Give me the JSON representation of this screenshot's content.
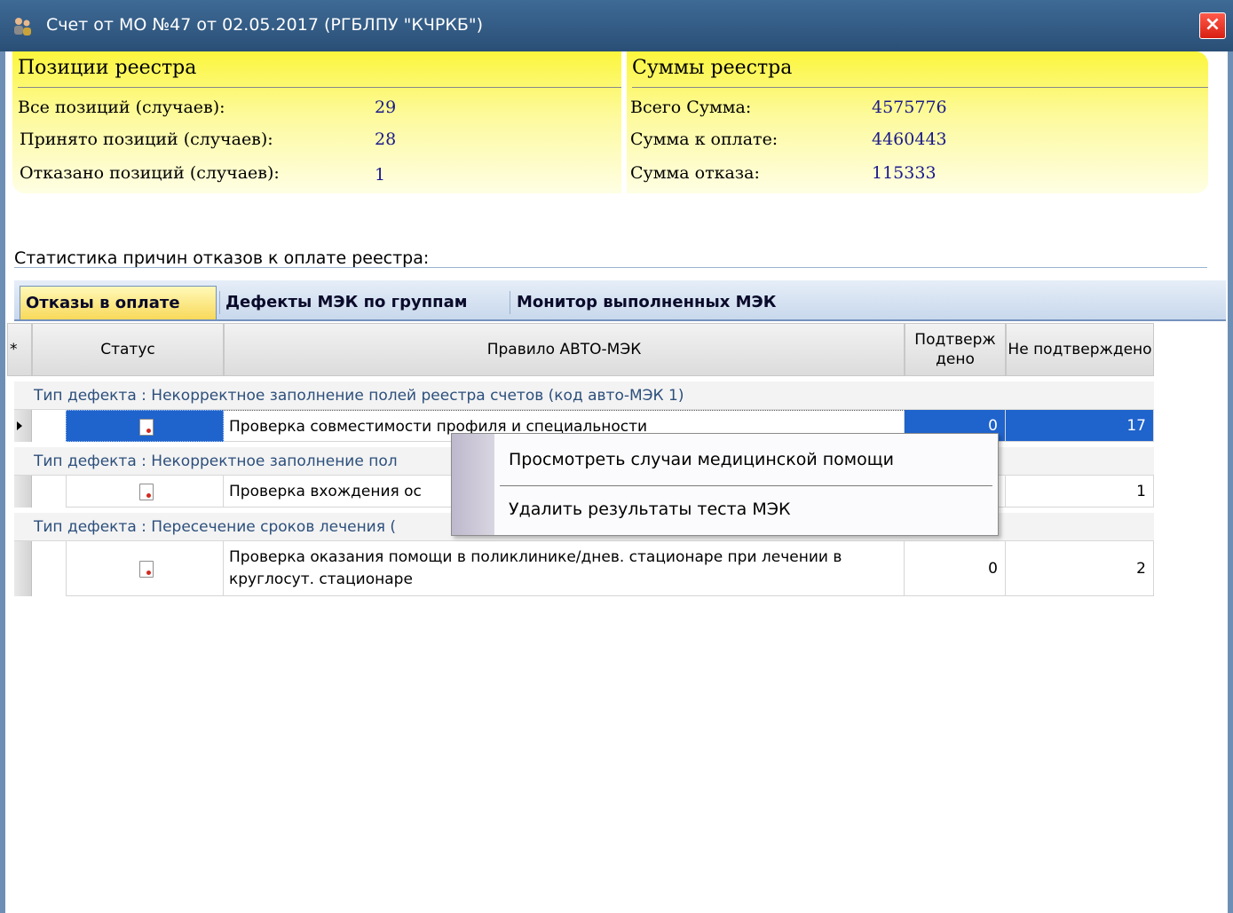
{
  "window": {
    "title": "Счет от МО №47 от 02.05.2017 (РГБЛПУ \"КЧРКБ\")",
    "close_label": "×"
  },
  "positions": {
    "header": "Позиции реестра",
    "all_label": "Все позиций (случаев):",
    "all_value": "29",
    "accepted_label": "Принято позиций (случаев):",
    "accepted_value": "28",
    "rejected_label": "Отказано позиций (случаев):",
    "rejected_value": "1"
  },
  "sums": {
    "header": "Суммы реестра",
    "total_label": "Всего Сумма:",
    "total_value": "4575776",
    "to_pay_label": "Сумма к оплате:",
    "to_pay_value": "4460443",
    "rejected_label": "Сумма отказа:",
    "rejected_value": "115333"
  },
  "stats_label": "Статистика причин отказов к оплате реестра:",
  "tabs": [
    {
      "label": "Отказы в оплате",
      "active": true
    },
    {
      "label": "Дефекты МЭК по группам",
      "active": false
    },
    {
      "label": "Монитор выполненных МЭК",
      "active": false
    }
  ],
  "grid": {
    "columns": {
      "star": "*",
      "status": "Статус",
      "rule": "Правило АВТО-МЭК",
      "confirmed": "Подтверж дено",
      "not_confirmed": "Не подтверждено"
    },
    "groups": [
      {
        "label": "Тип дефекта : Некорректное заполнение полей реестра счетов (код авто-МЭК 1)",
        "rows": [
          {
            "rule": "Проверка совместимости профиля и специальности",
            "confirmed": "0",
            "not_confirmed": "17",
            "selected": true
          }
        ]
      },
      {
        "label": "Тип дефекта : Некорректное заполнение пол",
        "rows": [
          {
            "rule": "Проверка вхождения ос",
            "confirmed": "",
            "not_confirmed": "1",
            "selected": false
          }
        ]
      },
      {
        "label": "Тип дефекта : Пересечение сроков лечения (",
        "rows": [
          {
            "rule": "Проверка оказания помощи в поликлинике/днев. стационаре при лечении в круглосут. стационаре",
            "confirmed": "0",
            "not_confirmed": "2",
            "selected": false
          }
        ]
      }
    ]
  },
  "context_menu": {
    "items": [
      "Просмотреть случаи медицинской помощи",
      "Удалить результаты теста МЭК"
    ]
  },
  "colors": {
    "titlebar": "#2f5880",
    "selection": "#1f63cc",
    "panel_yellow": "#fcf63c"
  }
}
